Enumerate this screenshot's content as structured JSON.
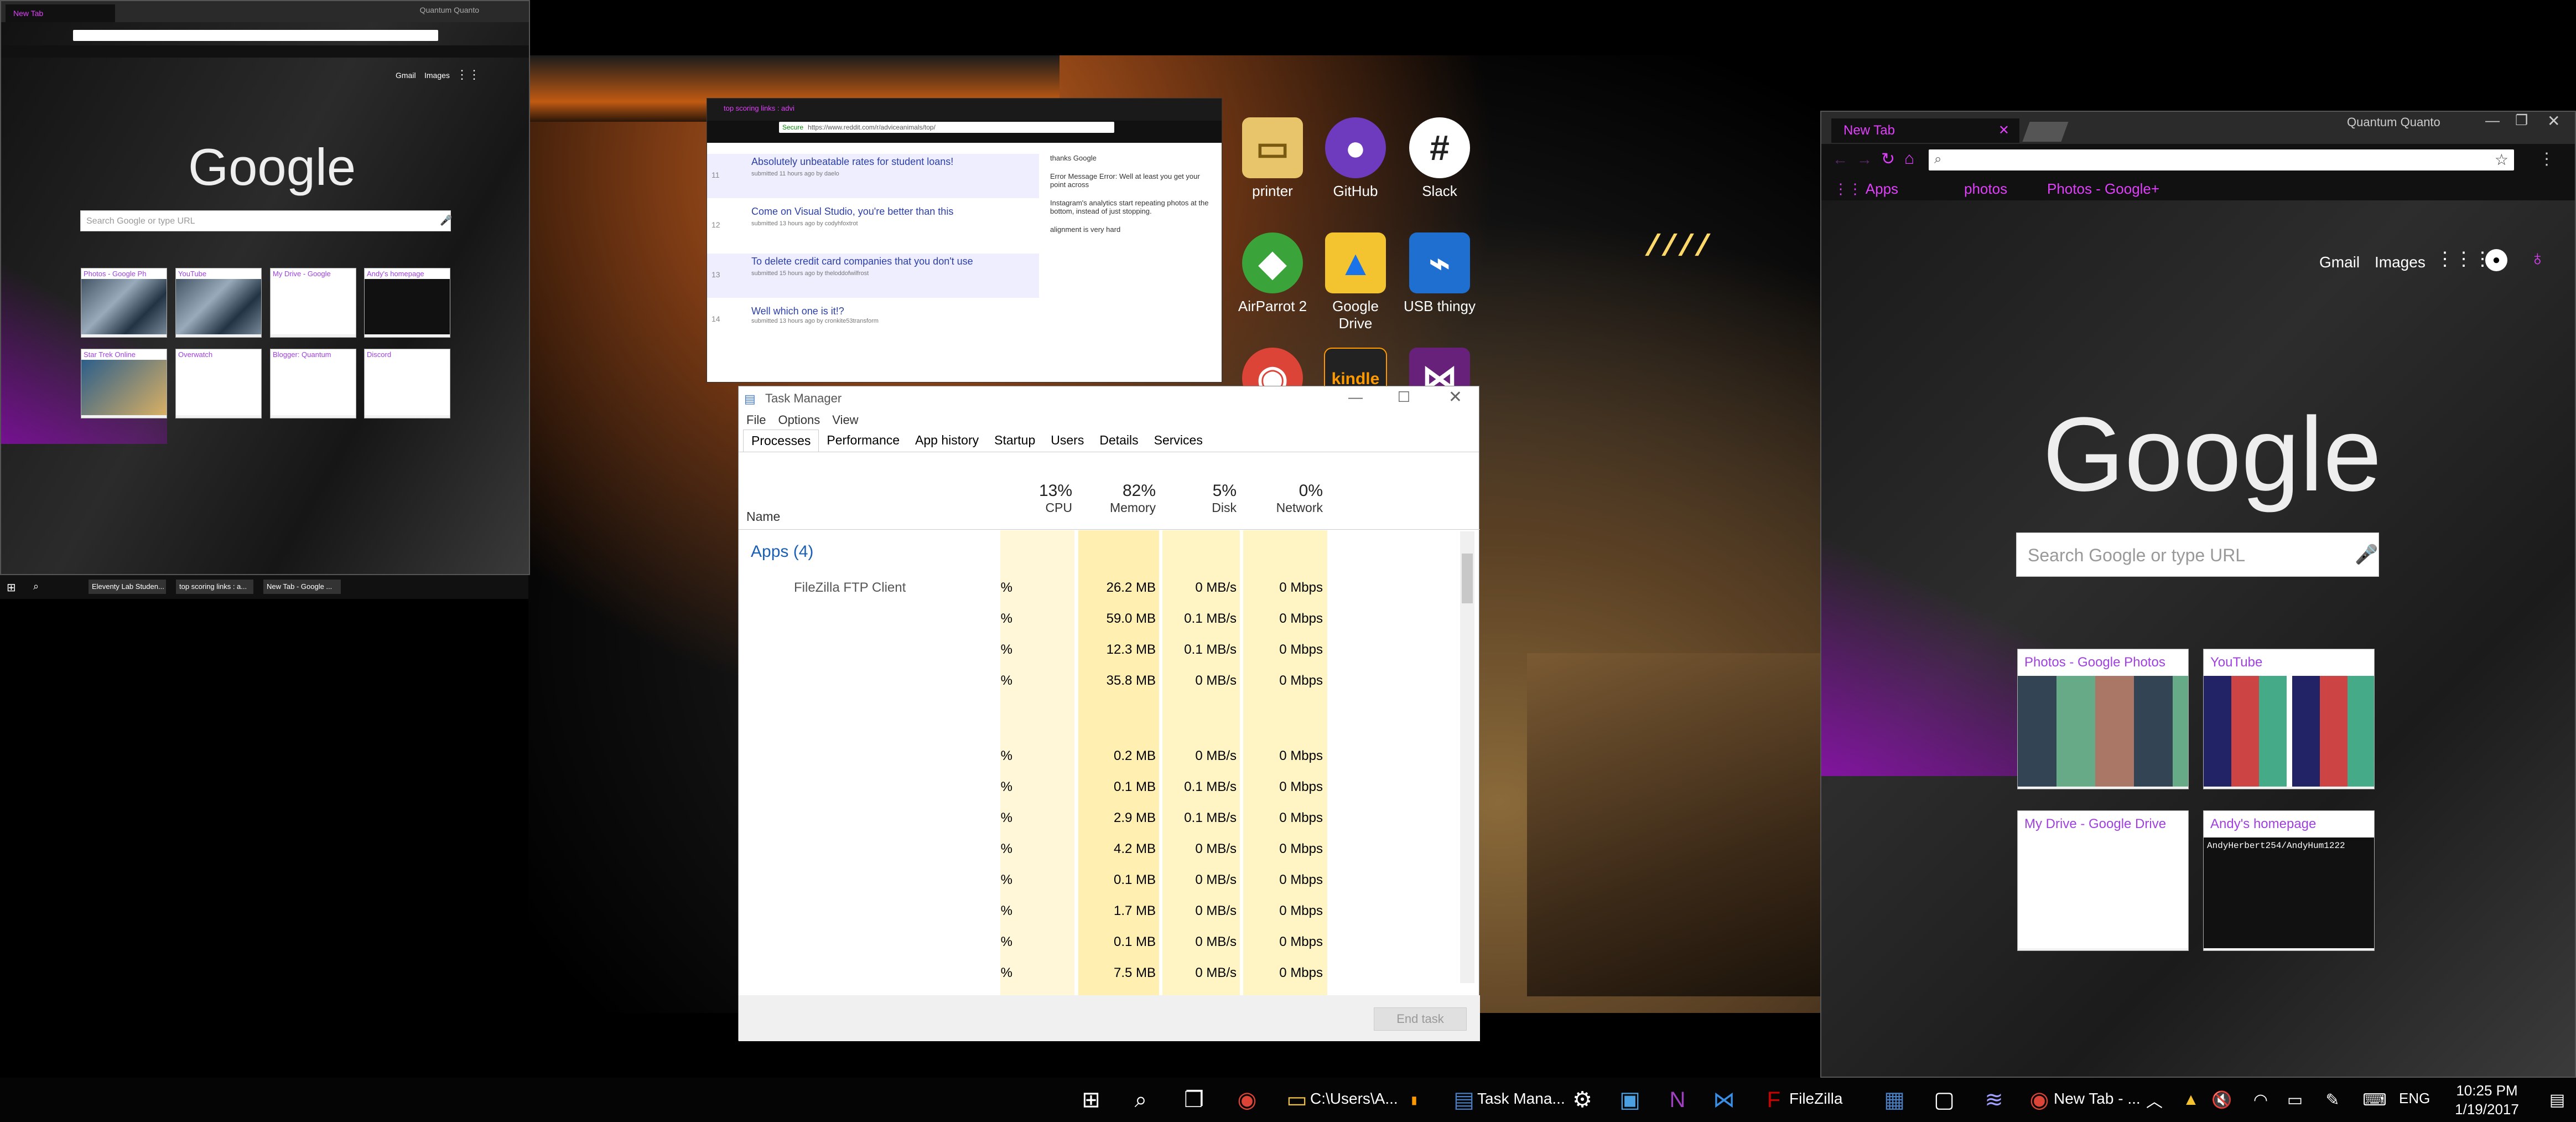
{
  "desktop": {
    "icons": [
      {
        "label": "printer",
        "icon": "folder-icon"
      },
      {
        "label": "GitHub",
        "icon": "github-icon"
      },
      {
        "label": "Slack",
        "icon": "slack-icon"
      },
      {
        "label": "AirParrot 2",
        "icon": "airparrot-icon"
      },
      {
        "label": "Google Drive",
        "icon": "drive-icon"
      },
      {
        "label": "USB thingy",
        "icon": "usb-icon"
      },
      {
        "label": "kindle",
        "icon": "kindle-icon"
      }
    ]
  },
  "chrome_small": {
    "tab_title": "New Tab",
    "user": "Quantum Quanto",
    "search_placeholder": "Search Google or type URL",
    "logo": "Google",
    "gmail": "Gmail",
    "images": "Images",
    "tiles": [
      "Photos - Google Ph",
      "YouTube",
      "My Drive - Google",
      "Andy's homepage",
      "Star Trek Online",
      "Overwatch",
      "Blogger: Quantum",
      "Discord"
    ]
  },
  "chrome_large": {
    "tab_title": "New Tab",
    "user": "Quantum Quanto",
    "bookmark_apps": "Apps",
    "bookmark_photos": "photos",
    "bookmark_photos_google": "Photos - Google+",
    "gmail": "Gmail",
    "images": "Images",
    "logo": "Google",
    "search_placeholder": "Search Google or type URL",
    "tiles": [
      {
        "title": "Photos - Google Photos"
      },
      {
        "title": "YouTube"
      },
      {
        "title": "My Drive - Google Drive"
      },
      {
        "title": "Andy's homepage"
      }
    ],
    "tile_text_andy": "AndyHerbert254/AndyHum1222"
  },
  "reddit": {
    "tab_title": "top scoring links : advi",
    "url_secure": "Secure",
    "url": "https://www.reddit.com/r/adviceanimals/top/",
    "posts": [
      {
        "rank": "11",
        "title": "Absolutely unbeatable rates for student loans!",
        "meta": "submitted 11 hours ago by daelo"
      },
      {
        "rank": "12",
        "title": "Come on Visual Studio, you're better than this",
        "meta": "submitted 13 hours ago by codyhfoxtrot"
      },
      {
        "rank": "13",
        "title": "To delete credit card companies that you don't use",
        "meta": "submitted 15 hours ago by theloddofwilfrost"
      },
      {
        "rank": "14",
        "title": "Well which one is it!?",
        "meta": "submitted 13 hours ago by cronkite53transform"
      }
    ],
    "sidebar": [
      "thanks Google",
      "Error Message Error: Well at least you get your point across",
      "Instagram's analytics start repeating photos at the bottom, instead of just stopping.",
      "alignment is very hard"
    ]
  },
  "task_manager": {
    "title": "Task Manager",
    "menu": [
      "File",
      "Options",
      "View"
    ],
    "tabs": [
      "Processes",
      "Performance",
      "App history",
      "Startup",
      "Users",
      "Details",
      "Services"
    ],
    "columns": {
      "name": "Name",
      "cpu_pct": "13%",
      "cpu": "CPU",
      "mem_pct": "82%",
      "mem": "Memory",
      "disk_pct": "5%",
      "disk": "Disk",
      "net_pct": "0%",
      "net": "Network"
    },
    "group": "Apps (4)",
    "first_row_name": "FileZilla FTP Client",
    "rows": [
      {
        "cpu": "%",
        "mem": "26.2 MB",
        "disk": "0 MB/s",
        "net": "0 Mbps"
      },
      {
        "cpu": "%",
        "mem": "59.0 MB",
        "disk": "0.1 MB/s",
        "net": "0 Mbps"
      },
      {
        "cpu": "%",
        "mem": "12.3 MB",
        "disk": "0.1 MB/s",
        "net": "0 Mbps"
      },
      {
        "cpu": "%",
        "mem": "35.8 MB",
        "disk": "0 MB/s",
        "net": "0 Mbps"
      },
      {
        "cpu": "",
        "mem": "",
        "disk": "",
        "net": ""
      },
      {
        "cpu": "%",
        "mem": "0.2 MB",
        "disk": "0 MB/s",
        "net": "0 Mbps"
      },
      {
        "cpu": "%",
        "mem": "0.1 MB",
        "disk": "0.1 MB/s",
        "net": "0 Mbps"
      },
      {
        "cpu": "%",
        "mem": "2.9 MB",
        "disk": "0.1 MB/s",
        "net": "0 Mbps"
      },
      {
        "cpu": "%",
        "mem": "4.2 MB",
        "disk": "0 MB/s",
        "net": "0 Mbps"
      },
      {
        "cpu": "%",
        "mem": "0.1 MB",
        "disk": "0 MB/s",
        "net": "0 Mbps"
      },
      {
        "cpu": "%",
        "mem": "1.7 MB",
        "disk": "0 MB/s",
        "net": "0 Mbps"
      },
      {
        "cpu": "%",
        "mem": "0.1 MB",
        "disk": "0 MB/s",
        "net": "0 Mbps"
      },
      {
        "cpu": "%",
        "mem": "7.5 MB",
        "disk": "0 MB/s",
        "net": "0 Mbps"
      }
    ],
    "end_task": "End task"
  },
  "mini_taskbar": {
    "items": [
      "Eleventy Lab Studen...",
      "top scoring links : a...",
      "New Tab - Google ..."
    ],
    "time": "10:25 PM",
    "date": "1/19/2017"
  },
  "taskbar": {
    "explorer_label": "C:\\Users\\A...",
    "taskmgr_label": "Task Mana...",
    "filezilla_label": "FileZilla",
    "chrome_label": "New Tab - ...",
    "language": "ENG",
    "time": "10:25 PM",
    "date": "1/19/2017"
  }
}
